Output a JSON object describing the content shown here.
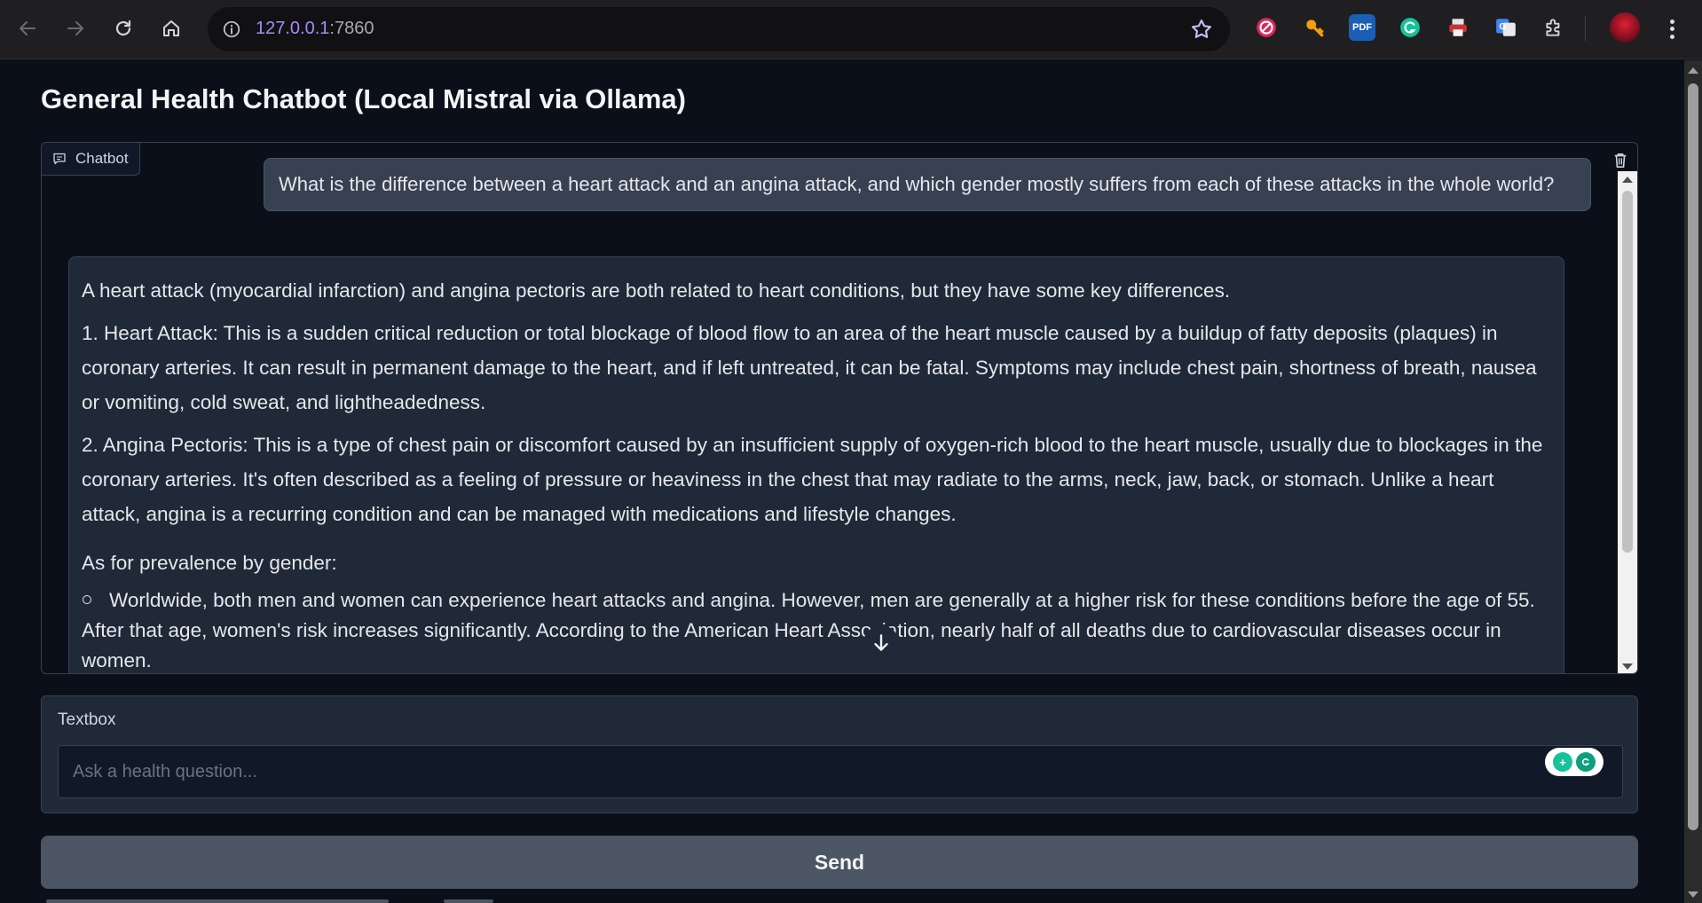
{
  "browser": {
    "url_host": "127.0.0.1",
    "url_port": ":7860",
    "extensions": [
      "blocker-icon",
      "key-icon",
      "pdf-icon",
      "grammarly-icon",
      "printer-icon",
      "translate-icon",
      "puzzle-icon"
    ],
    "pdf_label": "PDF",
    "translate_label": "G"
  },
  "page": {
    "title": "General Health Chatbot (Local Mistral via Ollama)"
  },
  "chatbot": {
    "label": "Chatbot",
    "user_message": "What is the difference between a heart attack and an angina attack, and which gender mostly suffers from each of these attacks in the whole world?",
    "bot_message": {
      "intro": "A heart attack (myocardial infarction) and angina pectoris are both related to heart conditions, but they have some key differences.",
      "point1": "1. Heart Attack: This is a sudden critical reduction or total blockage of blood flow to an area of the heart muscle caused by a buildup of fatty deposits (plaques) in coronary arteries. It can result in permanent damage to the heart, and if left untreated, it can be fatal. Symptoms may include chest pain, shortness of breath, nausea or vomiting, cold sweat, and lightheadedness.",
      "point2": "2. Angina Pectoris: This is a type of chest pain or discomfort caused by an insufficient supply of oxygen-rich blood to the heart muscle, usually due to blockages in the coronary arteries. It's often described as a feeling of pressure or heaviness in the chest that may radiate to the arms, neck, jaw, back, or stomach. Unlike a heart attack, angina is a recurring condition and can be managed with medications and lifestyle changes.",
      "gender_heading": "As for prevalence by gender:",
      "bullet1": "Worldwide, both men and women can experience heart attacks and angina. However, men are generally at a higher risk for these conditions before the age of 55. After that age, women's risk increases significantly. According to the American Heart Association, nearly half of all deaths due to cardiovascular diseases occur in women."
    }
  },
  "textbox": {
    "label": "Textbox",
    "placeholder": "Ask a health question...",
    "value": ""
  },
  "send": {
    "label": "Send"
  },
  "colors": {
    "page_bg": "#0b0f19",
    "panel_bg": "#1f2937",
    "border": "#374151",
    "button_bg": "#4b5563",
    "url_host": "#a78bfa"
  }
}
